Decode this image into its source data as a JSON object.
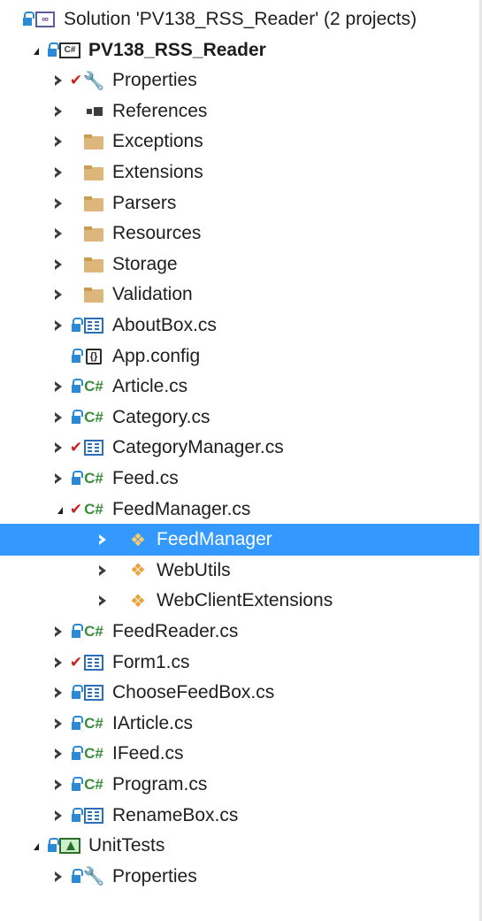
{
  "solution_explorer": {
    "rows": [
      {
        "indent": 0,
        "expander": "none",
        "status": "lock",
        "icon": "solution-icon",
        "label": "Solution 'PV138_RSS_Reader' (2 projects)",
        "bold": false
      },
      {
        "indent": 1,
        "expander": "expanded",
        "status": "lock",
        "icon": "csharp-project-icon",
        "label": "PV138_RSS_Reader",
        "bold": true
      },
      {
        "indent": 2,
        "expander": "collapsed",
        "status": "check",
        "icon": "wrench-icon",
        "label": "Properties"
      },
      {
        "indent": 2,
        "expander": "collapsed",
        "status": "none",
        "icon": "references-icon",
        "label": "References"
      },
      {
        "indent": 2,
        "expander": "collapsed",
        "status": "none",
        "icon": "folder-icon",
        "label": "Exceptions"
      },
      {
        "indent": 2,
        "expander": "collapsed",
        "status": "none",
        "icon": "folder-icon",
        "label": "Extensions"
      },
      {
        "indent": 2,
        "expander": "collapsed",
        "status": "none",
        "icon": "folder-icon",
        "label": "Parsers"
      },
      {
        "indent": 2,
        "expander": "collapsed",
        "status": "none",
        "icon": "folder-icon",
        "label": "Resources"
      },
      {
        "indent": 2,
        "expander": "collapsed",
        "status": "none",
        "icon": "folder-icon",
        "label": "Storage"
      },
      {
        "indent": 2,
        "expander": "collapsed",
        "status": "none",
        "icon": "folder-icon",
        "label": "Validation"
      },
      {
        "indent": 2,
        "expander": "collapsed",
        "status": "lock",
        "icon": "form-icon",
        "label": "AboutBox.cs"
      },
      {
        "indent": 2,
        "expander": "none",
        "status": "lock",
        "icon": "config-icon",
        "label": "App.config"
      },
      {
        "indent": 2,
        "expander": "collapsed",
        "status": "lock",
        "icon": "csharp-file-icon",
        "label": "Article.cs"
      },
      {
        "indent": 2,
        "expander": "collapsed",
        "status": "lock",
        "icon": "csharp-file-icon",
        "label": "Category.cs"
      },
      {
        "indent": 2,
        "expander": "collapsed",
        "status": "check",
        "icon": "form-icon",
        "label": "CategoryManager.cs"
      },
      {
        "indent": 2,
        "expander": "collapsed",
        "status": "lock",
        "icon": "csharp-file-icon",
        "label": "Feed.cs"
      },
      {
        "indent": 2,
        "expander": "expanded",
        "status": "check",
        "icon": "csharp-file-icon",
        "label": "FeedManager.cs"
      },
      {
        "indent": 3,
        "expander": "collapsed",
        "status": "none",
        "icon": "class-icon",
        "label": "FeedManager",
        "selected": true
      },
      {
        "indent": 3,
        "expander": "collapsed",
        "status": "none",
        "icon": "class-icon",
        "label": "WebUtils"
      },
      {
        "indent": 3,
        "expander": "collapsed",
        "status": "none",
        "icon": "class-icon",
        "label": "WebClientExtensions"
      },
      {
        "indent": 2,
        "expander": "collapsed",
        "status": "lock",
        "icon": "csharp-file-icon",
        "label": "FeedReader.cs"
      },
      {
        "indent": 2,
        "expander": "collapsed",
        "status": "check",
        "icon": "form-icon",
        "label": "Form1.cs"
      },
      {
        "indent": 2,
        "expander": "collapsed",
        "status": "lock",
        "icon": "form-icon",
        "label": "ChooseFeedBox.cs"
      },
      {
        "indent": 2,
        "expander": "collapsed",
        "status": "lock",
        "icon": "csharp-file-icon",
        "label": "IArticle.cs"
      },
      {
        "indent": 2,
        "expander": "collapsed",
        "status": "lock",
        "icon": "csharp-file-icon",
        "label": "IFeed.cs"
      },
      {
        "indent": 2,
        "expander": "collapsed",
        "status": "lock",
        "icon": "csharp-file-icon",
        "label": "Program.cs"
      },
      {
        "indent": 2,
        "expander": "collapsed",
        "status": "lock",
        "icon": "form-icon",
        "label": "RenameBox.cs"
      },
      {
        "indent": 1,
        "expander": "expanded",
        "status": "lock",
        "icon": "test-project-icon",
        "label": "UnitTests",
        "bold": false
      },
      {
        "indent": 2,
        "expander": "collapsed",
        "status": "lock",
        "icon": "wrench-icon",
        "label": "Properties"
      }
    ]
  },
  "colors": {
    "selection": "#3399ff",
    "folder": "#dcb67a",
    "csharp": "#3c8c3c",
    "check": "#d01f1f",
    "lock": "#2b8ad6"
  }
}
